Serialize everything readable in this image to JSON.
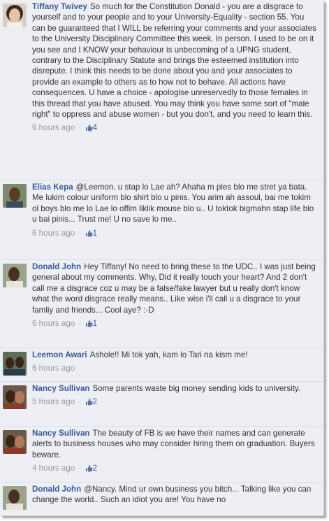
{
  "comments": [
    {
      "author": "Tiffany Twivey",
      "text": "So much for the Constitution Donald - you are a disgrace to yourself and to your people and to your University-Equality - section 55. You can be guaranteed that I WILL be referring your comments and your associates to the University Disciplinary Committee this week. In person. I used to be on it you see and I KNOW your behaviour is unbecoming of a UPNG student, contrary to the Disciplinary Statute and brings the esteemed institution into disrepute. I think this needs to be done about you and your associates to provide an example to others as to how not to behave. All actions have consequences. U have a choice - apologise unreservedly to those females in this thread that you have abused. You may think you have some sort of \"male right\" to oppress and abuse women - but you don't, and you need to learn this.",
      "time": "6 hours ago",
      "likes": "4"
    },
    {
      "author": "Elias Kepa",
      "text": "@Leemon. u stap lo Lae ah? Ahaha m ples blo me stret ya bata. Me lukim colour uniform blo shirt blo u pinis. You arim ah assoul, bai me tokim ol boys blo me lo Lae lo offim liklik mouse blo u.. U toktok bigmahn stap life blo u bai pinis... Trust me! U no save lo me..",
      "time": "6 hours ago",
      "likes": "1"
    },
    {
      "author": "Donald John",
      "text": "Hey Tiffany! No need to bring these to the UDC.. I was just being general about my comments. Why, Did it really touch your heart? And 2 don't call me a disgrace coz u may be a false/fake lawyer but u really don't know what the word disgrace really means.. Like wise i'll call u a disgrace to your famliy and friends... Cool aye? :-D",
      "time": "6 hours ago",
      "likes": "1"
    },
    {
      "author": "Leemon Awari",
      "text": "Ashole!! Mi tok yah, kam lo Tari na kism me!",
      "time": "6 hours ago",
      "likes": ""
    },
    {
      "author": "Nancy Sullivan",
      "text": "Some parents waste big money sending kids to university.",
      "time": "5 hours ago",
      "likes": "2"
    },
    {
      "author": "Nancy Sullivan",
      "text": "The beauty of FB is we have their names and can generate alerts to business houses who may consider hiring them on graduation. Buyers beware.",
      "time": "4 hours ago",
      "likes": "2"
    },
    {
      "author": "Donald John",
      "text": "@Nancy. Mind ur own business you bitch... Talking like you can change the world.. Such an idiot you are! You have no",
      "time": "",
      "likes": ""
    }
  ],
  "meta_separator": "·",
  "colors": {
    "link": "#3b5998",
    "meta": "#999999",
    "background": "#edeff4",
    "text": "#333333"
  },
  "icons": {
    "like": "thumbs-up-icon"
  }
}
